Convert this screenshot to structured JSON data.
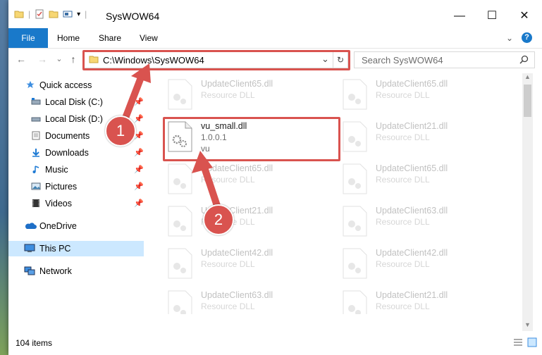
{
  "window": {
    "title": "SysWOW64",
    "minimize": "—",
    "maximize": "☐",
    "close": "✕"
  },
  "ribbon": {
    "tabs": [
      "File",
      "Home",
      "Share",
      "View"
    ],
    "expand": "⌄",
    "help": "?"
  },
  "nav": {
    "back": "←",
    "forward": "→",
    "recent": "⌄",
    "up": "↑"
  },
  "address": {
    "path": "C:\\Windows\\SysWOW64",
    "dropdown": "⌄",
    "refresh": "↻"
  },
  "search": {
    "placeholder": "Search SysWOW64",
    "icon": "search-icon"
  },
  "sidebar": {
    "quick_access": "Quick access",
    "items": [
      {
        "label": "Local Disk (C:)",
        "icon": "drive-icon",
        "pinned": true
      },
      {
        "label": "Local Disk (D:)",
        "icon": "drive-icon",
        "pinned": true
      },
      {
        "label": "Documents",
        "icon": "documents-icon",
        "pinned": true
      },
      {
        "label": "Downloads",
        "icon": "downloads-icon",
        "pinned": true
      },
      {
        "label": "Music",
        "icon": "music-icon",
        "pinned": true
      },
      {
        "label": "Pictures",
        "icon": "pictures-icon",
        "pinned": true
      },
      {
        "label": "Videos",
        "icon": "videos-icon",
        "pinned": true
      }
    ],
    "onedrive": "OneDrive",
    "this_pc": "This PC",
    "network": "Network"
  },
  "files": [
    {
      "name": "UpdateClient65.dll",
      "type": "Resource DLL"
    },
    {
      "name": "UpdateClient65.dll",
      "type": "Resource DLL"
    },
    {
      "name": "vu_small.dll",
      "version": "1.0.0.1",
      "company": "vu",
      "highlighted": true
    },
    {
      "name": "UpdateClient21.dll",
      "type": "Resource DLL"
    },
    {
      "name": "UpdateClient65.dll",
      "type": "Resource DLL"
    },
    {
      "name": "UpdateClient65.dll",
      "type": "Resource DLL"
    },
    {
      "name": "UpdateClient21.dll",
      "type": "Resource DLL"
    },
    {
      "name": "UpdateClient63.dll",
      "type": "Resource DLL"
    },
    {
      "name": "UpdateClient42.dll",
      "type": "Resource DLL"
    },
    {
      "name": "UpdateClient42.dll",
      "type": "Resource DLL"
    },
    {
      "name": "UpdateClient63.dll",
      "type": "Resource DLL"
    },
    {
      "name": "UpdateClient21.dll",
      "type": "Resource DLL"
    }
  ],
  "status": {
    "count": "104 items"
  },
  "annotations": {
    "step1": "1",
    "step2": "2",
    "color": "#d9534f"
  }
}
